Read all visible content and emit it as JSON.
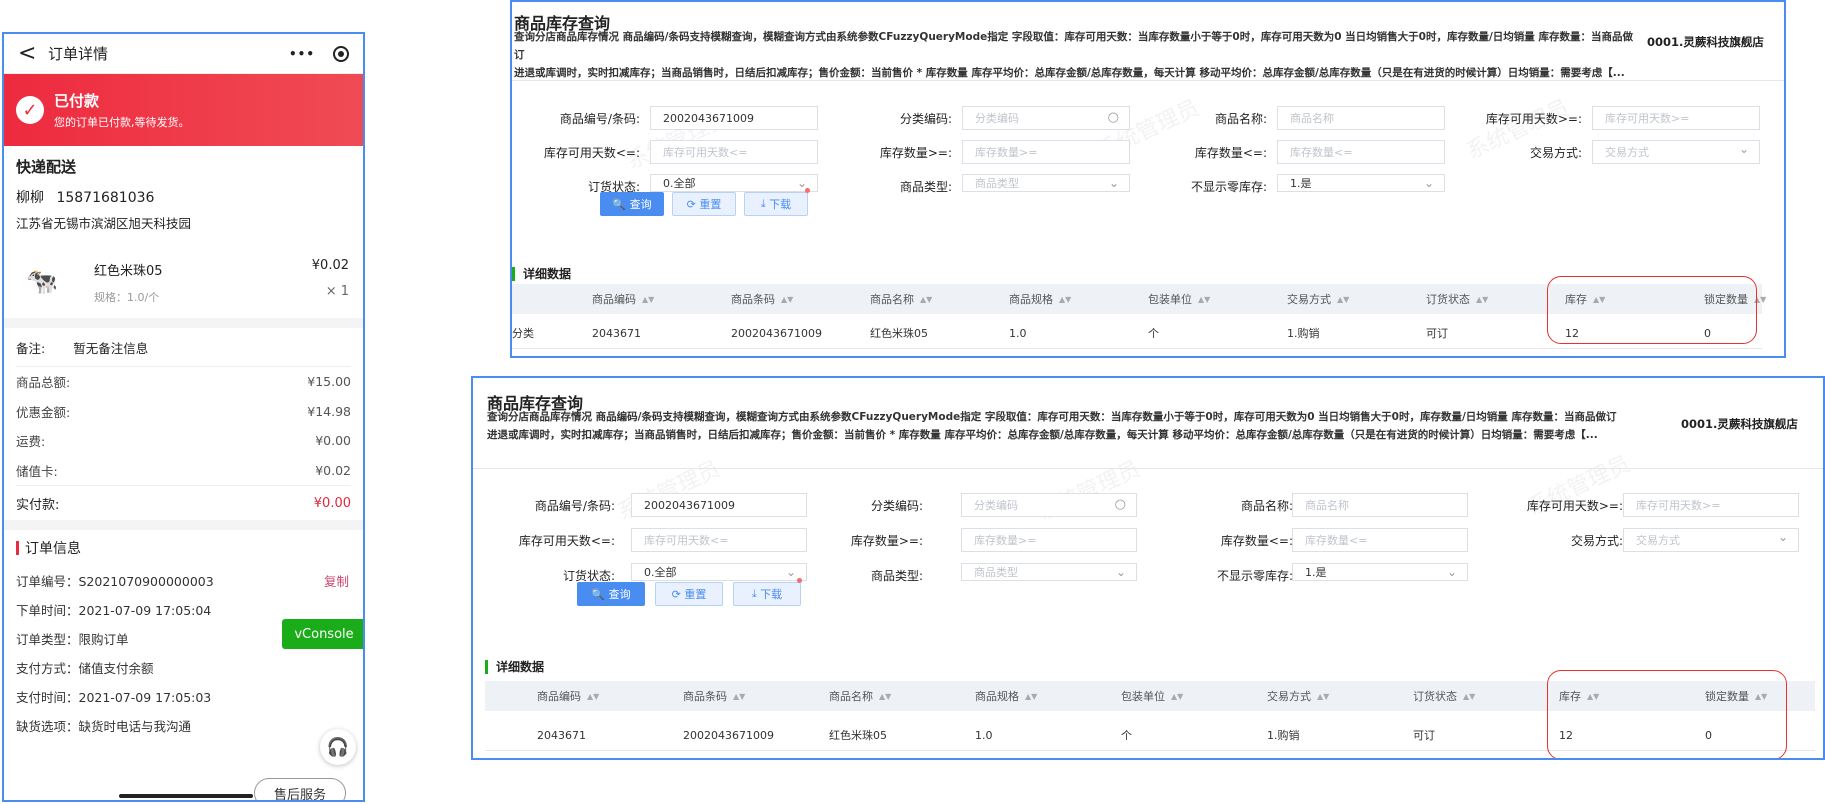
{
  "mobile": {
    "header_title": "订单详情",
    "header_back": "<",
    "menu_glyph": "•••",
    "banner_title": "已付款",
    "banner_sub": "您的订单已付款,等待发货。",
    "delivery_title": "快递配送",
    "contact_name": "柳柳",
    "contact_phone": "15871681036",
    "address": "江苏省无锡市滨湖区旭天科技园",
    "product_name": "红色米珠05",
    "product_spec": "规格：1.0/个",
    "product_price": "¥0.02",
    "product_qty": "× 1",
    "note_label": "备注:",
    "note_value": "暂无备注信息",
    "amounts": [
      {
        "label": "商品总额:",
        "value": "¥15.00"
      },
      {
        "label": "优惠金额:",
        "value": "¥14.98"
      },
      {
        "label": "运费:",
        "value": "¥0.00"
      },
      {
        "label": "储值卡:",
        "value": "¥0.02"
      }
    ],
    "paid_label": "实付款:",
    "paid_value": "¥0.00",
    "info_title": "订单信息",
    "info": [
      {
        "text": "订单编号：S2021070900000003"
      },
      {
        "text": "下单时间：2021-07-09 17:05:04"
      },
      {
        "text": "订单类型：限购订单"
      },
      {
        "text": "支付方式：储值支付余额"
      },
      {
        "text": "支付时间：2021-07-09 17:05:03"
      },
      {
        "text": "缺货选项：缺货时电话与我沟通"
      }
    ],
    "copy_label": "复制",
    "vconsole": "vConsole",
    "after_sale": "售后服务"
  },
  "desktop": {
    "title": "商品库存查询",
    "desc_line1": "查询分店商品库存情况 商品编码/条码支持模糊查询，模糊查询方式由系统参数CFuzzyQueryMode指定 字段取值：库存可用天数：当库存数量小于等于0时，库存可用天数为0 当日均销售大于0时，库存数量/日均销量 库存数量：当商品做订",
    "desc_line2": "进退或库调时，实时扣减库存；当商品销售时，日结后扣减库存；售价金额：当前售价 * 库存数量 库存平均价：总库存金额/总库存数量，每天计算 移动平均价：总库存金额/总库存数量（只是在有进货的时候计算）日均销量：需要考虑【...",
    "store": "0001.灵蕨科技旗舰店",
    "form": {
      "code_label": "商品编号/条码:",
      "code_value": "2002043671009",
      "category_label": "分类编码:",
      "category_ph": "分类编码",
      "name_label": "商品名称:",
      "name_ph": "商品名称",
      "days_ge_label": "库存可用天数>=:",
      "days_ge_ph": "库存可用天数>=",
      "days_le_label": "库存可用天数<=:",
      "days_le_ph": "库存可用天数<=",
      "qty_ge_label": "库存数量>=:",
      "qty_ge_ph": "库存数量>=",
      "qty_le_label": "库存数量<=:",
      "qty_le_ph": "库存数量<=",
      "trade_label": "交易方式:",
      "trade_ph": "交易方式",
      "order_status_label": "订货状态:",
      "order_status_value": "0.全部",
      "type_label": "商品类型:",
      "type_ph": "商品类型",
      "zero_label": "不显示零库存:",
      "zero_value": "1.是"
    },
    "buttons": {
      "query": "查询",
      "reset": "重置",
      "download": "下载"
    },
    "detail_title": "详细数据",
    "columns": [
      "商品编码",
      "商品条码",
      "商品名称",
      "商品规格",
      "包装单位",
      "交易方式",
      "订货状态",
      "库存",
      "锁定数量"
    ],
    "row": [
      "2043671",
      "2002043671009",
      "红色米珠05",
      "1.0",
      "个",
      "1.购销",
      "可订",
      "12",
      "0"
    ],
    "row_prefix": "分类",
    "watermark": "系统管理员"
  }
}
